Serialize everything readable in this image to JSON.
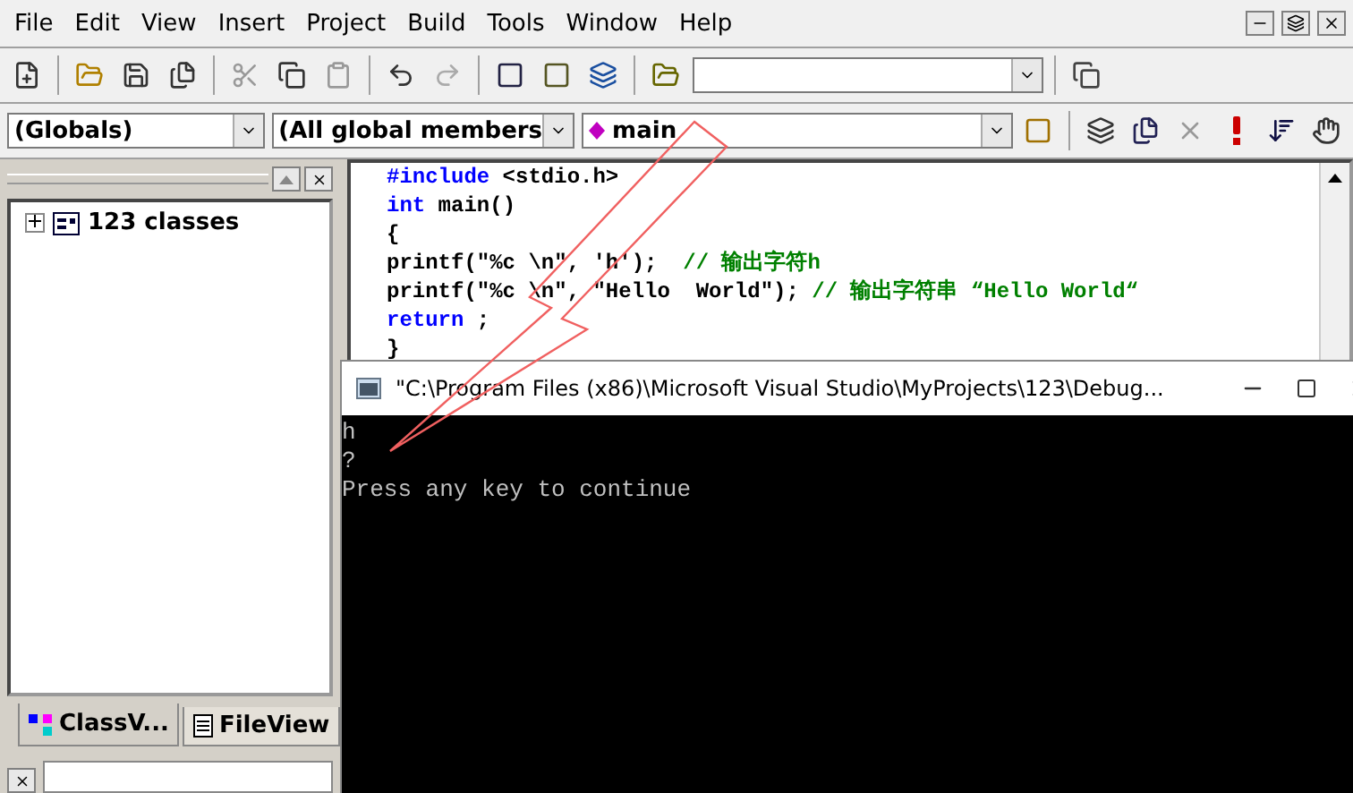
{
  "menu": [
    {
      "label": "File"
    },
    {
      "label": "Edit"
    },
    {
      "label": "View"
    },
    {
      "label": "Insert"
    },
    {
      "label": "Project"
    },
    {
      "label": "Build"
    },
    {
      "label": "Tools"
    },
    {
      "label": "Window"
    },
    {
      "label": "Help"
    }
  ],
  "wizard_bar": {
    "scope": "(Globals)",
    "members": "(All global members",
    "function": "main"
  },
  "class_view": {
    "tree": [
      {
        "label": "123 classes",
        "expanded": false
      }
    ],
    "tabs": [
      {
        "label": "ClassV...",
        "selected": true
      },
      {
        "label": "FileView",
        "selected": false
      }
    ]
  },
  "editor": {
    "lines": [
      [
        {
          "kind": "keyword",
          "text": "#include"
        },
        {
          "kind": "plain",
          "text": " <stdio.h>"
        }
      ],
      [
        {
          "kind": "keyword",
          "text": "int"
        },
        {
          "kind": "plain",
          "text": " main()"
        }
      ],
      [
        {
          "kind": "plain",
          "text": "{"
        }
      ],
      [
        {
          "kind": "plain",
          "text": "printf(\"%c \\n\", 'h');  "
        },
        {
          "kind": "comment",
          "text": "// 输出字符h"
        }
      ],
      [
        {
          "kind": "plain",
          "text": "printf(\"%c \\n\", \"Hello  World\"); "
        },
        {
          "kind": "comment",
          "text": "// 输出字符串 “Hello World“"
        }
      ],
      [
        {
          "kind": "keyword",
          "text": "return"
        },
        {
          "kind": "plain",
          "text": " ;"
        }
      ],
      [
        {
          "kind": "plain",
          "text": "}"
        }
      ]
    ]
  },
  "console": {
    "title": "\"C:\\Program Files (x86)\\Microsoft Visual Studio\\MyProjects\\123\\Debug...",
    "lines": [
      "h",
      "?",
      "Press any key to continue"
    ]
  }
}
